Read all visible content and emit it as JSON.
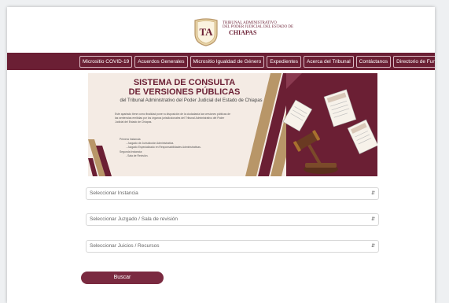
{
  "header": {
    "org_line1": "TRIBUNAL ADMINISTRATIVO",
    "org_line2": "DEL PODER JUDICIAL DEL ESTADO DE",
    "state": "CHIAPAS",
    "logo_letters": "TA"
  },
  "nav": {
    "items": [
      "Micrositio COVID-19",
      "Acuerdos Generales",
      "Micrositio Igualdad de Género",
      "Expedientes",
      "Acerca del Tribunal",
      "Contáctanos",
      "Directorio de Funcionarios"
    ]
  },
  "banner": {
    "title1": "SISTEMA DE CONSULTA",
    "title2": "DE VERSIONES PÚBLICAS",
    "subtitle": "del Tribunal Administrativo del Poder Judicial del Estado de Chiapas",
    "description": "Este apartado tiene como finalidad poner a disposición de la ciudadanía las versiones públicas de las sentencias emitidas por los órganos jurisdiccionales del Tribunal Administrativo del Poder Judicial del Estado de Chiapas.",
    "list": {
      "primera": "Primera Instancia:",
      "item1": "- Juzgado de Jurisdicción Administrativa.",
      "item2": "- Juzgado Especializado en Responsabilidades Administrativas.",
      "segunda": "Segunda Instancia:",
      "item3": "- Sala de Revisión."
    },
    "colors": {
      "burgundy": "#6b1f34",
      "cream": "#f4ebe4",
      "gold": "#b89668"
    }
  },
  "selects": {
    "instancia": "Seleccionar Instancia",
    "juzgado": "Seleccionar Juzgado / Sala de revisión",
    "juicios": "Seleccionar Juicios / Recursos"
  },
  "search_button": "Buscar"
}
